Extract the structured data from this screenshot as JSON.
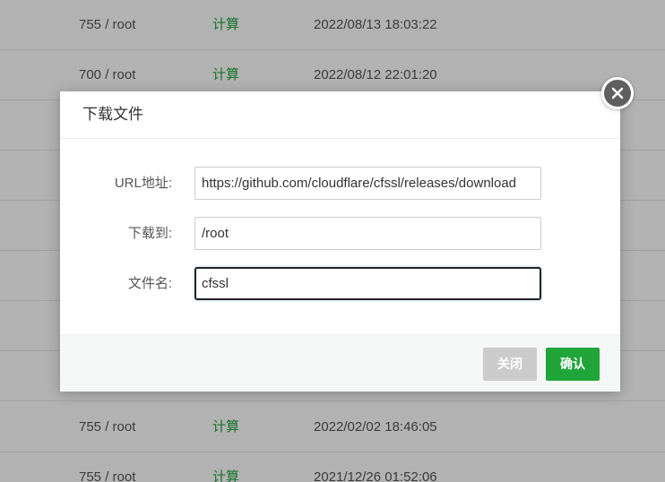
{
  "background_table": {
    "rows": [
      {
        "perm": "755 / root",
        "size": "计算",
        "time": "2022/08/13 18:03:22"
      },
      {
        "perm": "700 / root",
        "size": "计算",
        "time": "2022/08/12 22:01:20"
      },
      {
        "perm": "",
        "size": "",
        "time": ""
      },
      {
        "perm": "",
        "size": "",
        "time": ""
      },
      {
        "perm": "",
        "size": "",
        "time": ""
      },
      {
        "perm": "",
        "size": "",
        "time": ""
      },
      {
        "perm": "",
        "size": "",
        "time": ""
      },
      {
        "perm": "",
        "size": "",
        "time": ""
      },
      {
        "perm": "755 / root",
        "size": "计算",
        "time": "2022/02/02 18:46:05"
      },
      {
        "perm": "755 / root",
        "size": "计算",
        "time": "2021/12/26 01:52:06"
      }
    ]
  },
  "dialog": {
    "title": "下载文件",
    "close_icon": "close-icon",
    "fields": {
      "url": {
        "label": "URL地址:",
        "value": "https://github.com/cloudflare/cfssl/releases/download"
      },
      "target": {
        "label": "下载到:",
        "value": "/root"
      },
      "filename": {
        "label": "文件名:",
        "value": "cfssl"
      }
    },
    "buttons": {
      "close": "关闭",
      "confirm": "确认"
    }
  },
  "colors": {
    "accent": "#20a53a",
    "overlay": "rgba(0,0,0,0.30)",
    "disabled_button": "#cbcbcb"
  }
}
